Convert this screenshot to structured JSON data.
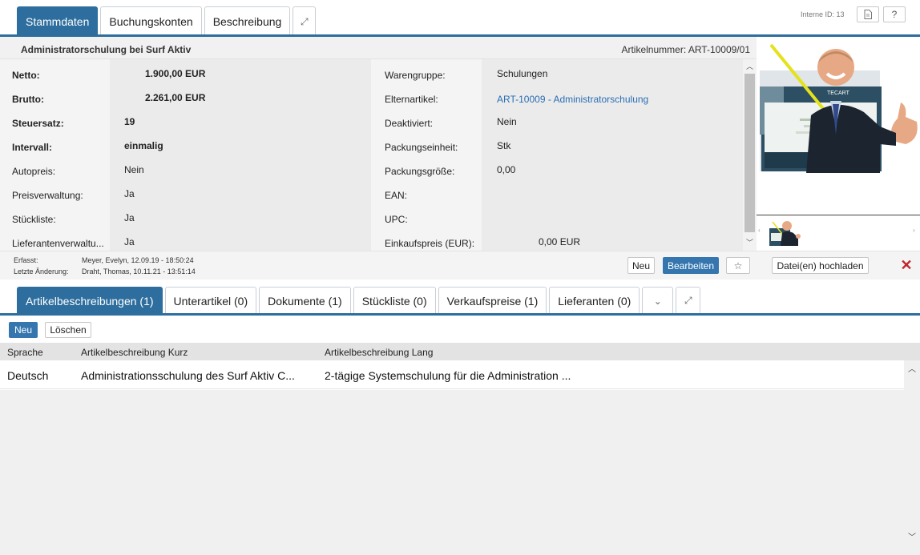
{
  "top_tabs": [
    "Stammdaten",
    "Buchungskonten",
    "Beschreibung"
  ],
  "internal_id": "Interne ID: 13",
  "help_label": "?",
  "header": {
    "title": "Administratorschulung bei Surf Aktiv",
    "article_number": "Artikelnummer: ART-10009/01"
  },
  "left_fields": [
    {
      "label": "Netto:",
      "value": "1.900,00 EUR"
    },
    {
      "label": "Brutto:",
      "value": "2.261,00 EUR"
    },
    {
      "label": "Steuersatz:",
      "value": "19"
    },
    {
      "label": "Intervall:",
      "value": "einmalig"
    },
    {
      "label": "Autopreis:",
      "value": "Nein"
    },
    {
      "label": "Preisverwaltung:",
      "value": "Ja"
    },
    {
      "label": "Stückliste:",
      "value": "Ja"
    },
    {
      "label": "Lieferantenverwaltu...",
      "value": "Ja"
    }
  ],
  "right_fields": [
    {
      "label": "Warengruppe:",
      "value": "Schulungen"
    },
    {
      "label": "Elternartikel:",
      "value": "ART-10009 - Administratorschulung"
    },
    {
      "label": "Deaktiviert:",
      "value": "Nein"
    },
    {
      "label": "Packungseinheit:",
      "value": "Stk"
    },
    {
      "label": "Packungsgröße:",
      "value": "0,00"
    },
    {
      "label": "EAN:",
      "value": ""
    },
    {
      "label": "UPC:",
      "value": ""
    },
    {
      "label": "Einkaufspreis (EUR):",
      "value": "0,00 EUR"
    }
  ],
  "meta": {
    "created_label": "Erfasst:",
    "created_value": "Meyer, Evelyn, 12.09.19 - 18:50:24",
    "changed_label": "Letzte Änderung:",
    "changed_value": "Draht, Thomas, 10.11.21 - 13:51:14"
  },
  "actions": {
    "new": "Neu",
    "edit": "Bearbeiten",
    "upload": "Datei(en) hochladen",
    "close": "✕"
  },
  "lower_tabs": [
    "Artikelbeschreibungen (1)",
    "Unterartikel (0)",
    "Dokumente (1)",
    "Stückliste (0)",
    "Verkaufspreise (1)",
    "Lieferanten (0)"
  ],
  "grid_toolbar": {
    "new": "Neu",
    "delete": "Löschen"
  },
  "grid": {
    "columns": [
      "Sprache",
      "Artikelbeschreibung Kurz",
      "Artikelbeschreibung Lang"
    ],
    "rows": [
      [
        "Deutsch",
        "Administrationsschulung des Surf Aktiv C...",
        "2-tägige Systemschulung für die Administration ..."
      ]
    ]
  },
  "colors": {
    "accent": "#2e6e9e",
    "primary_button": "#3576ae",
    "link": "#2a6fb4",
    "close": "#c0272d"
  }
}
